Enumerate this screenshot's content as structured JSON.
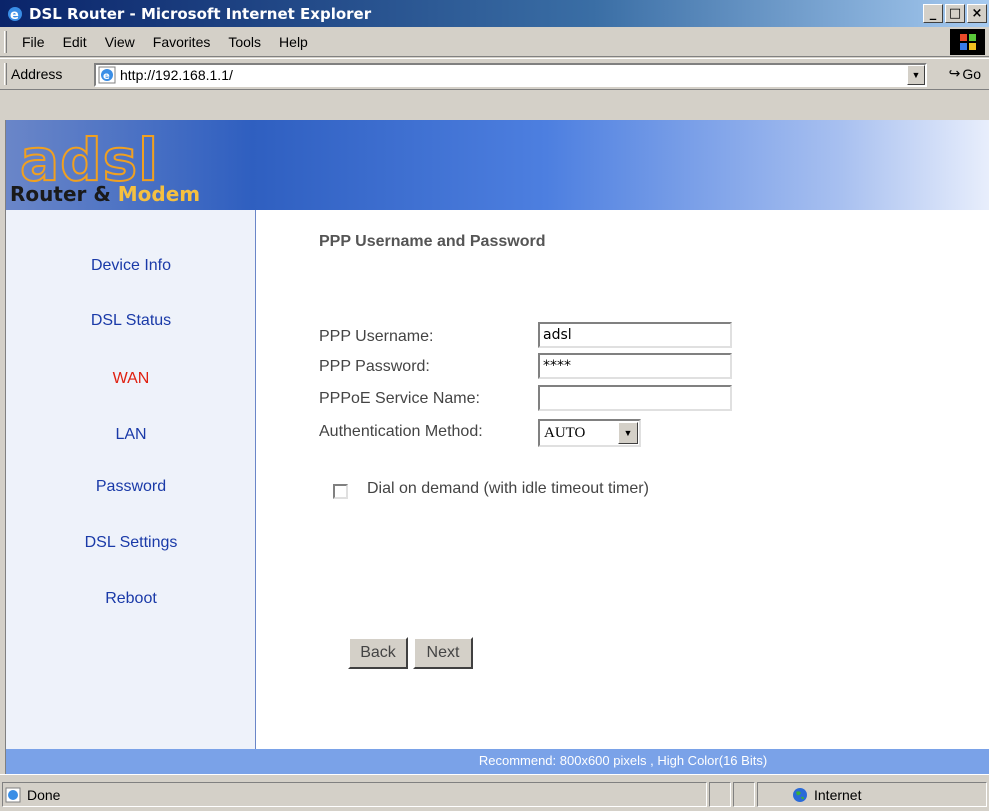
{
  "window": {
    "title": "DSL Router - Microsoft Internet Explorer",
    "minimize_label": "_",
    "maximize_label": "□",
    "close_label": "×"
  },
  "menu": {
    "items": [
      "File",
      "Edit",
      "View",
      "Favorites",
      "Tools",
      "Help"
    ]
  },
  "address": {
    "label": "Address",
    "url": "http://192.168.1.1/",
    "go_label": "Go"
  },
  "banner": {
    "logo_letters": "adsl",
    "logo_sub_a": "Router & ",
    "logo_sub_b": "Modem"
  },
  "sidebar": {
    "items": [
      {
        "label": "Device Info",
        "active": false
      },
      {
        "label": "DSL Status",
        "active": false
      },
      {
        "label": "WAN",
        "active": true
      },
      {
        "label": "LAN",
        "active": false
      },
      {
        "label": "Password",
        "active": false
      },
      {
        "label": "DSL Settings",
        "active": false
      },
      {
        "label": "Reboot",
        "active": false
      }
    ]
  },
  "form": {
    "heading": "PPP Username and Password",
    "username_label": "PPP Username:",
    "username_value": "adsl",
    "password_label": "PPP Password:",
    "password_value": "****",
    "service_label": "PPPoE Service Name:",
    "service_value": "",
    "auth_label": "Authentication Method:",
    "auth_value": "AUTO",
    "dial_label": "Dial on demand (with idle timeout timer)",
    "dial_checked": false,
    "back_label": "Back",
    "next_label": "Next"
  },
  "footer": {
    "note": "Recommend: 800x600 pixels , High Color(16 Bits)"
  },
  "status": {
    "text": "Done",
    "zone": "Internet"
  },
  "colors": {
    "nav_link": "#1a3aa8",
    "nav_active": "#e02010",
    "footer_bg": "#7aa2e8"
  }
}
